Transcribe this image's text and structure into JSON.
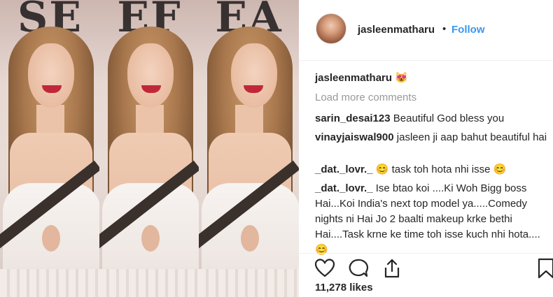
{
  "photo": {
    "sign_text": "SEEFAEA",
    "panels": [
      "left",
      "center",
      "right"
    ]
  },
  "post": {
    "username": "jasleenmatharu",
    "separator": "•",
    "follow_label": "Follow",
    "caption_user": "jasleenmatharu",
    "caption_emoji": "😻",
    "load_more_label": "Load more comments",
    "comments": [
      {
        "user": "sarin_desai123",
        "text": "Beautiful God bless you"
      },
      {
        "user": "vinayjaiswal900",
        "text": "jasleen ji aap bahut beautiful hai"
      },
      {
        "user": "_dat._lovr._",
        "text": "😊 task toh hota nhi isse 😊"
      },
      {
        "user": "_dat._lovr._",
        "text": "Ise btao koi ....Ki Woh Bigg boss Hai...Koi India's next top model ya.....Comedy nights ni Hai Jo 2 baalti makeup krke bethi Hai....Task krne ke time toh isse kuch nhi hota.... 😊"
      }
    ],
    "likes_label": "11,278 likes",
    "icons": [
      "heart-icon",
      "comment-icon",
      "share-icon",
      "bookmark-icon"
    ],
    "colors": {
      "accent": "#3897f0",
      "muted": "#999999",
      "text": "#262626"
    }
  }
}
